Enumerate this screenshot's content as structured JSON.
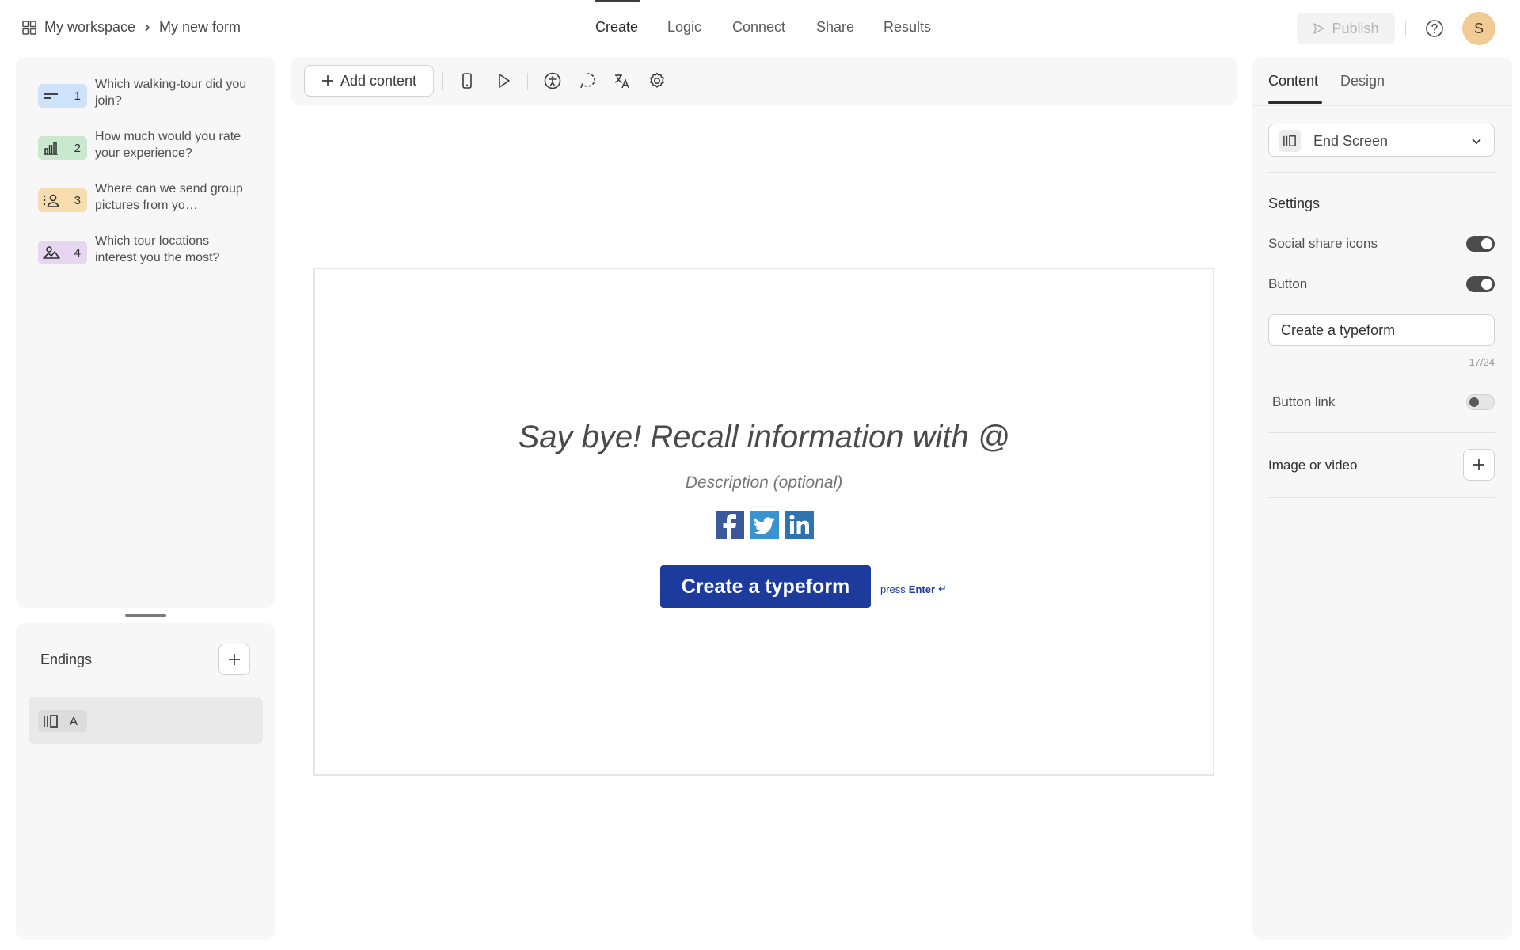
{
  "breadcrumb": {
    "workspace": "My workspace",
    "form": "My new form"
  },
  "nav": {
    "tabs": [
      "Create",
      "Logic",
      "Connect",
      "Share",
      "Results"
    ],
    "active": "Create"
  },
  "header": {
    "publish_label": "Publish",
    "avatar_initial": "S"
  },
  "questions": [
    {
      "number": "1",
      "text": "Which walking-tour did you join?",
      "icon": "short-text-icon",
      "color": "#cfe2fb"
    },
    {
      "number": "2",
      "text": "How much would you rate your experience?",
      "icon": "bar-chart-icon",
      "color": "#c9e9cf"
    },
    {
      "number": "3",
      "text": "Where can we send group pictures from yo…",
      "icon": "contact-info-icon",
      "color": "#f6dcae"
    },
    {
      "number": "4",
      "text": "Which tour locations interest you the most?",
      "icon": "picture-choice-icon",
      "color": "#e6d6f2"
    }
  ],
  "endings": {
    "title": "Endings",
    "items": [
      {
        "letter": "A",
        "icon": "end-screen-icon"
      }
    ]
  },
  "toolbar": {
    "add_content_label": "Add content"
  },
  "canvas": {
    "headline": "Say bye! Recall information with @",
    "description": "Description (optional)",
    "social_icons": [
      "facebook-icon",
      "twitter-icon",
      "linkedin-icon"
    ],
    "cta_label": "Create a typeform",
    "press_prefix": "press",
    "press_key": "Enter",
    "press_glyph": "↵",
    "cta_color": "#1c3b9c"
  },
  "right_panel": {
    "tabs": [
      "Content",
      "Design"
    ],
    "active_tab": "Content",
    "type_select": "End Screen",
    "settings_title": "Settings",
    "social_share_label": "Social share icons",
    "social_share_on": true,
    "button_label": "Button",
    "button_on": true,
    "button_text_value": "Create a typeform",
    "button_text_counter": "17/24",
    "button_link_label": "Button link",
    "button_link_on": false,
    "image_video_label": "Image or video"
  }
}
